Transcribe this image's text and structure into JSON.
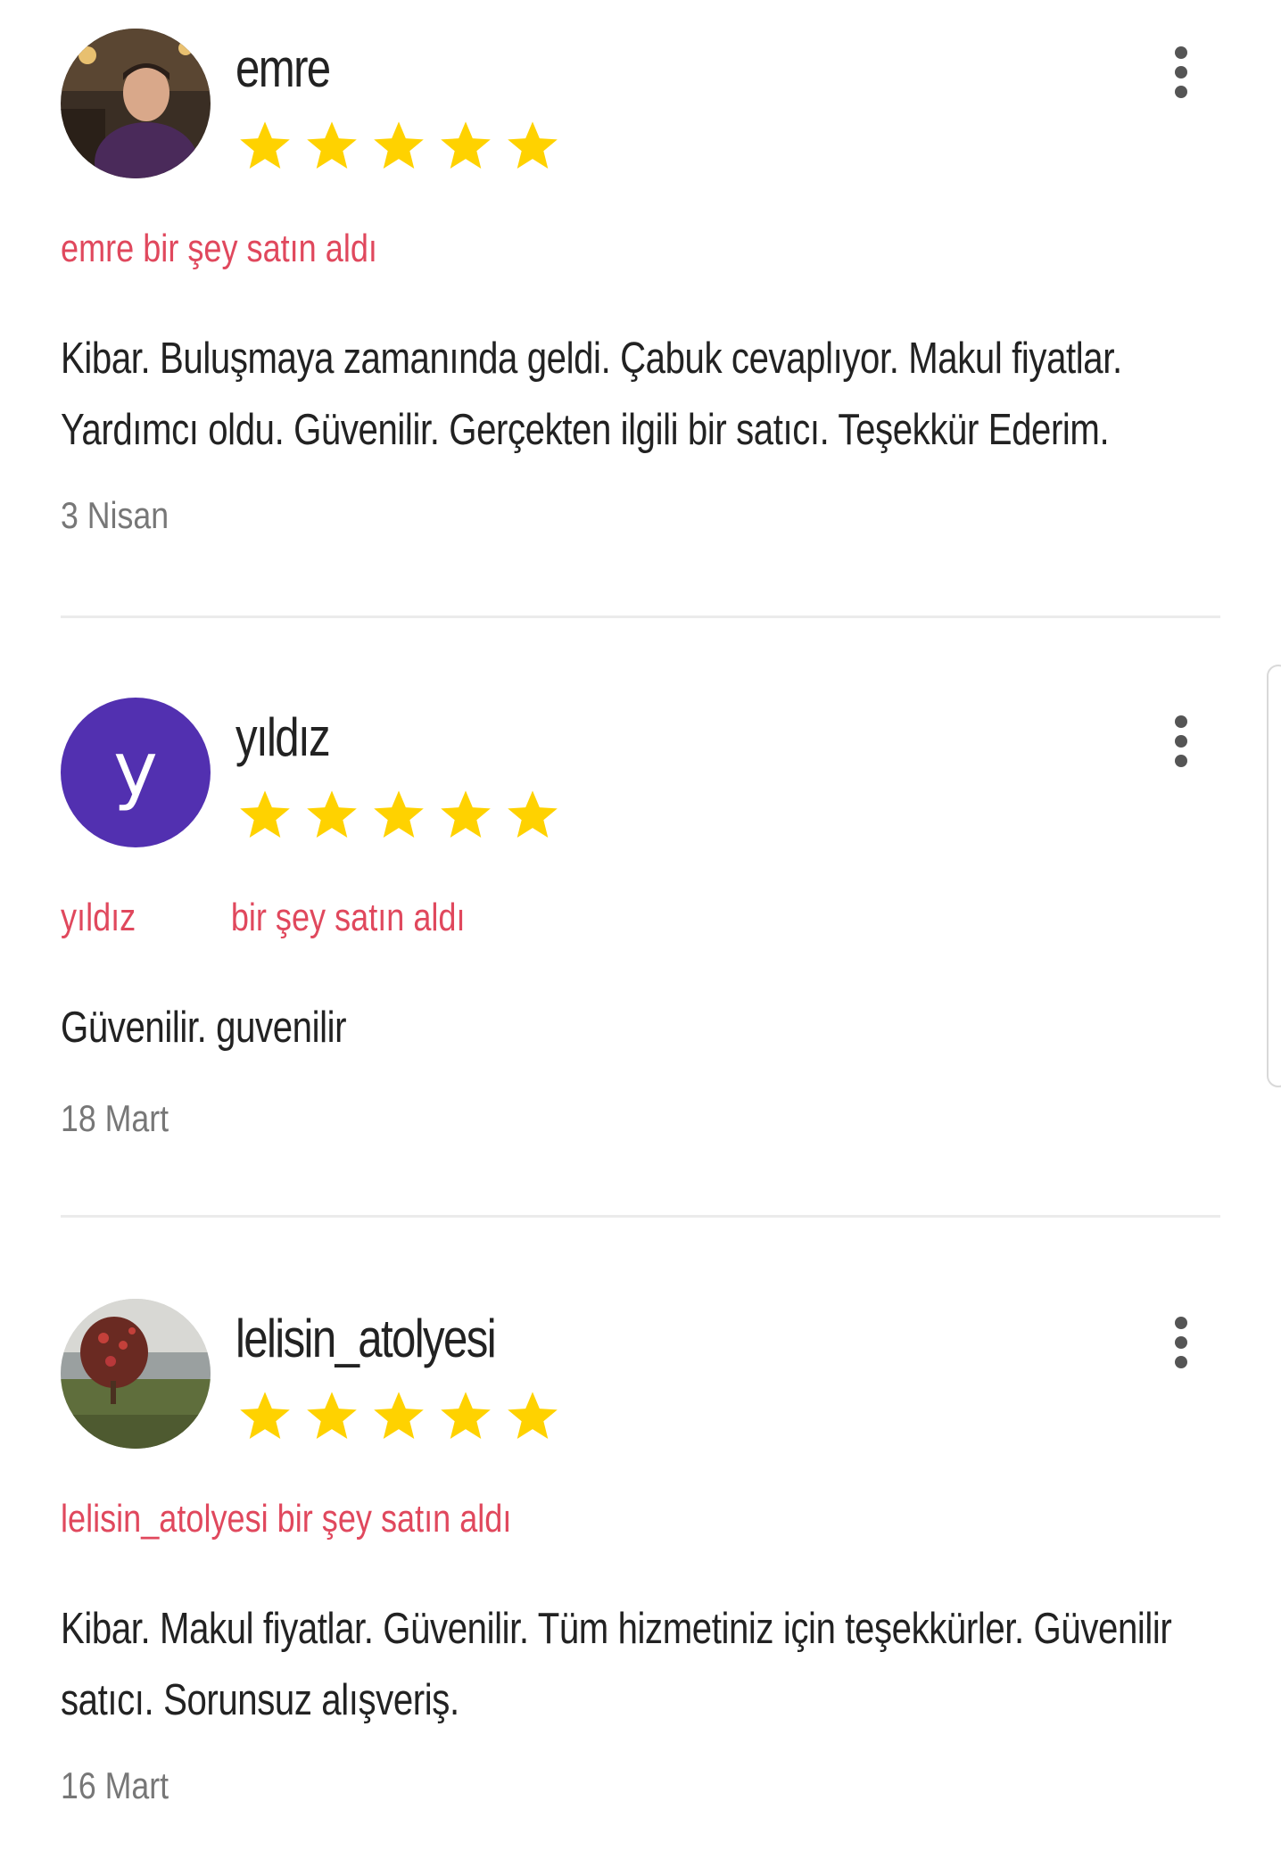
{
  "colors": {
    "star": "#FFD200",
    "purchase_text": "#E0485D",
    "date_text": "#777777",
    "avatar_yildiz_bg": "#5230B0"
  },
  "reviews": [
    {
      "username": "emre",
      "avatar": {
        "type": "photo",
        "icon": "user-photo-emre"
      },
      "rating": 5,
      "purchase_prefix": "emre",
      "purchase_text": "bir şey satın aldı",
      "body": "Kibar. Buluşmaya zamanında geldi. Çabuk cevaplıyor. Makul fiyatlar. Yardımcı oldu. Güvenilir. Gerçekten ilgili bir satıcı. Teşekkür Ederim.",
      "date": "3 Nisan"
    },
    {
      "username": "yıldız",
      "avatar": {
        "type": "letter",
        "letter": "y"
      },
      "rating": 5,
      "purchase_prefix": "yıldız",
      "purchase_text": "bir şey satın aldı",
      "body": "Güvenilir. guvenilir",
      "date": "18 Mart"
    },
    {
      "username": "lelisin_atolyesi",
      "avatar": {
        "type": "photo",
        "icon": "user-photo-lelisin"
      },
      "rating": 5,
      "purchase_prefix": "lelisin_atolyesi",
      "purchase_text": "bir şey satın aldı",
      "body": "Kibar. Makul fiyatlar. Güvenilir. Tüm hizmetiniz için teşekkürler. Güvenilir satıcı. Sorunsuz alışveriş.",
      "date": "16 Mart"
    }
  ]
}
